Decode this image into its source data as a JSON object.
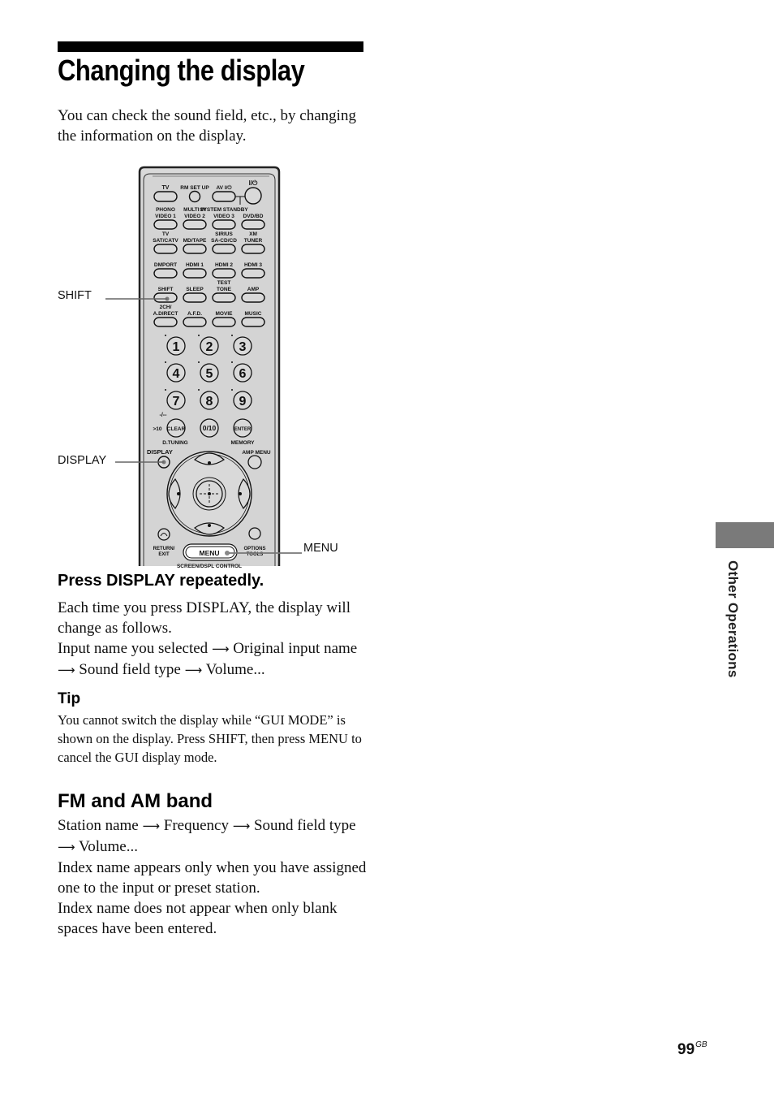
{
  "header": {
    "title": "Changing the display",
    "intro": "You can check the sound field, etc., by changing the information on the display."
  },
  "remote": {
    "callouts": {
      "shift": "SHIFT",
      "display": "DISPLAY",
      "menu": "MENU"
    },
    "rows": [
      {
        "labels": [
          [
            "TV"
          ],
          [
            "RM SET UP"
          ],
          [
            "AV I/⏻"
          ],
          [
            "I/⏻"
          ]
        ]
      },
      {
        "labels": [
          [
            "PHONO",
            "VIDEO 1"
          ],
          [
            "MULTI IN",
            "VIDEO 2"
          ],
          [
            "SYSTEM STANDBY",
            "VIDEO 3"
          ],
          [
            "",
            "DVD/BD"
          ]
        ]
      },
      {
        "labels": [
          [
            "TV",
            "SAT/CATV"
          ],
          [
            "",
            "MD/TAPE"
          ],
          [
            "SIRIUS",
            "SA-CD/CD"
          ],
          [
            "XM",
            "TUNER"
          ]
        ]
      },
      {
        "labels": [
          [
            "",
            "DMPORT"
          ],
          [
            "",
            "HDMI 1"
          ],
          [
            "",
            "HDMI 2"
          ],
          [
            "",
            "HDMI 3"
          ]
        ]
      },
      {
        "labels": [
          [
            "",
            "SHIFT"
          ],
          [
            "",
            "SLEEP"
          ],
          [
            "TEST",
            "TONE"
          ],
          [
            "",
            "AMP"
          ]
        ]
      },
      {
        "labels": [
          [
            "2CH/",
            "A.DIRECT"
          ],
          [
            "",
            "A.F.D."
          ],
          [
            "",
            "MOVIE"
          ],
          [
            "",
            "MUSIC"
          ]
        ]
      }
    ],
    "numpad": [
      "1",
      "2",
      "3",
      "4",
      "5",
      "6",
      "7",
      "8",
      "9"
    ],
    "bottom_keys": {
      "clear": "CLEAR",
      "zero": "0/10",
      "enter": "ENTER",
      "gt10": ">10",
      "dash": "-/--"
    },
    "sub_labels": {
      "d_tuning": "D.TUNING",
      "memory": "MEMORY",
      "display": "DISPLAY",
      "amp_menu": "AMP MENU",
      "return_exit": [
        "RETURN/",
        "EXIT"
      ],
      "options_tools": [
        "OPTIONS",
        "TOOLS"
      ],
      "menu": "MENU",
      "screen_control": "SCREEN/DSPL CONTROL"
    }
  },
  "press_section": {
    "heading": "Press DISPLAY repeatedly.",
    "line1": "Each time you press DISPLAY, the display will change as follows.",
    "sequence": [
      "Input name you selected",
      "Original input name",
      "Sound field type",
      "Volume..."
    ]
  },
  "tip": {
    "heading": "Tip",
    "text": "You cannot switch the display while “GUI MODE” is shown on the display. Press SHIFT, then press MENU to cancel the GUI display mode."
  },
  "fm_section": {
    "heading": "FM and AM band",
    "sequence": [
      "Station name",
      "Frequency",
      "Sound field type",
      "Volume..."
    ],
    "note1": "Index name appears only when you have assigned one to the input or preset station.",
    "note2": "Index name does not appear when only blank spaces have been entered."
  },
  "sidebar": {
    "section_label": "Other Operations"
  },
  "footer": {
    "page_number": "99",
    "page_suffix": "GB"
  }
}
